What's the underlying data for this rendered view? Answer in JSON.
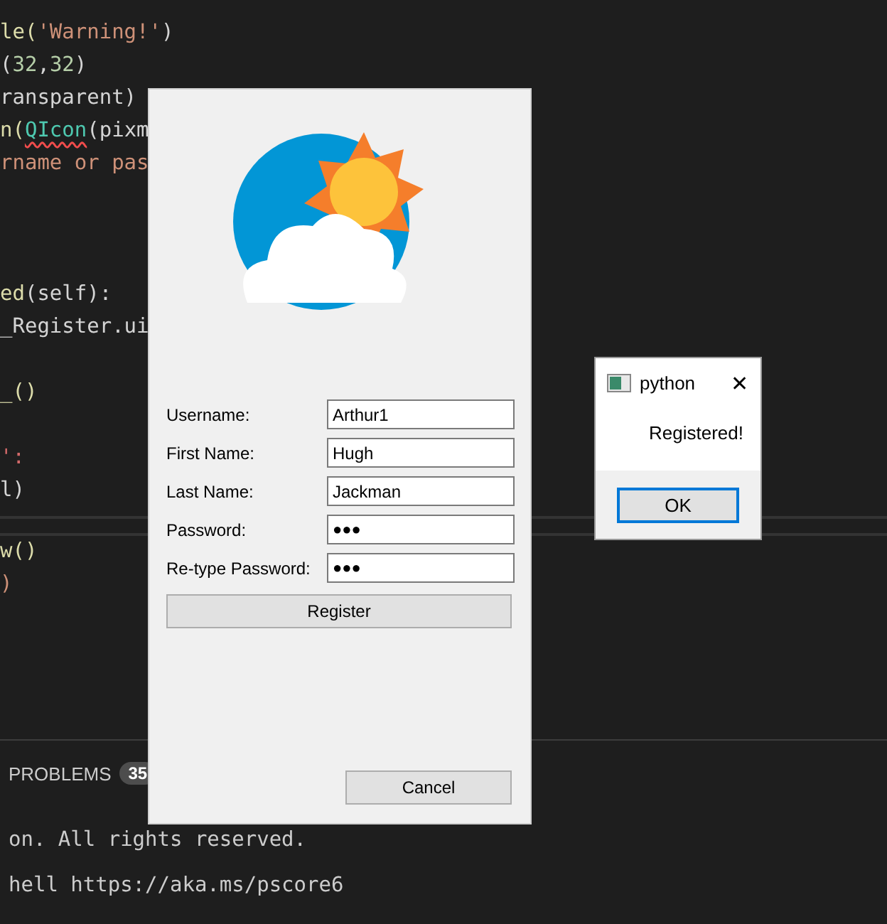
{
  "editor": {
    "code_lines": [
      {
        "segments": [
          {
            "text": "le(",
            "color": "#dcdcaa"
          },
          {
            "text": "'Warning!'",
            "color": "#ce9178"
          },
          {
            "text": ")",
            "color": "#d4d4d4"
          }
        ]
      },
      {
        "segments": [
          {
            "text": "(",
            "color": "#d4d4d4"
          },
          {
            "text": "32",
            "color": "#b5cea8"
          },
          {
            "text": ",",
            "color": "#d4d4d4"
          },
          {
            "text": "32",
            "color": "#b5cea8"
          },
          {
            "text": ")",
            "color": "#d4d4d4"
          }
        ]
      },
      {
        "segments": [
          {
            "text": "ransparent)",
            "color": "#d4d4d4"
          }
        ]
      },
      {
        "segments": [
          {
            "text": "n(",
            "color": "#dcdcaa"
          },
          {
            "text": "QIcon",
            "color": "#4ec9b0",
            "squiggle": true
          },
          {
            "text": "(pixm",
            "color": "#d4d4d4"
          }
        ]
      },
      {
        "segments": [
          {
            "text": "rname or pas",
            "color": "#ce9178"
          }
        ]
      },
      {
        "kind": "blank"
      },
      {
        "kind": "blank"
      },
      {
        "kind": "blank"
      },
      {
        "segments": [
          {
            "text": "ed",
            "color": "#dcdcaa"
          },
          {
            "text": "(self):",
            "color": "#d4d4d4"
          }
        ]
      },
      {
        "segments": [
          {
            "text": "_Register.ui",
            "color": "#d4d4d4"
          }
        ]
      },
      {
        "kind": "blank"
      },
      {
        "segments": [
          {
            "text": "_()",
            "color": "#dcdcaa"
          }
        ]
      },
      {
        "kind": "blank"
      },
      {
        "segments": [
          {
            "text": "':",
            "color": "#d16969"
          }
        ]
      },
      {
        "segments": [
          {
            "text": "l)",
            "color": "#d4d4d4"
          }
        ]
      }
    ],
    "lower_lines": [
      {
        "segments": [
          {
            "text": "w()",
            "color": "#dcdcaa"
          }
        ]
      },
      {
        "segments": [
          {
            "text": ")",
            "color": "#ce9178"
          }
        ]
      }
    ]
  },
  "panel": {
    "tab": {
      "label": "PROBLEMS",
      "badge": "35"
    },
    "terminal_lines": [
      "on. All rights reserved.",
      "hell https://aka.ms/pscore6"
    ]
  },
  "register_dialog": {
    "fields": [
      {
        "label": "Username:",
        "value": "Arthur1",
        "kind": "text"
      },
      {
        "label": "First Name:",
        "value": "Hugh",
        "kind": "text"
      },
      {
        "label": "Last Name:",
        "value": "Jackman",
        "kind": "text"
      },
      {
        "label": "Password:",
        "value": "●●●",
        "kind": "password"
      },
      {
        "label": "Re-type Password:",
        "value": "●●●",
        "kind": "password"
      }
    ],
    "register_button": "Register",
    "cancel_button": "Cancel"
  },
  "message_box": {
    "title": "python",
    "close": "✕",
    "message": "Registered!",
    "ok_button": "OK"
  }
}
